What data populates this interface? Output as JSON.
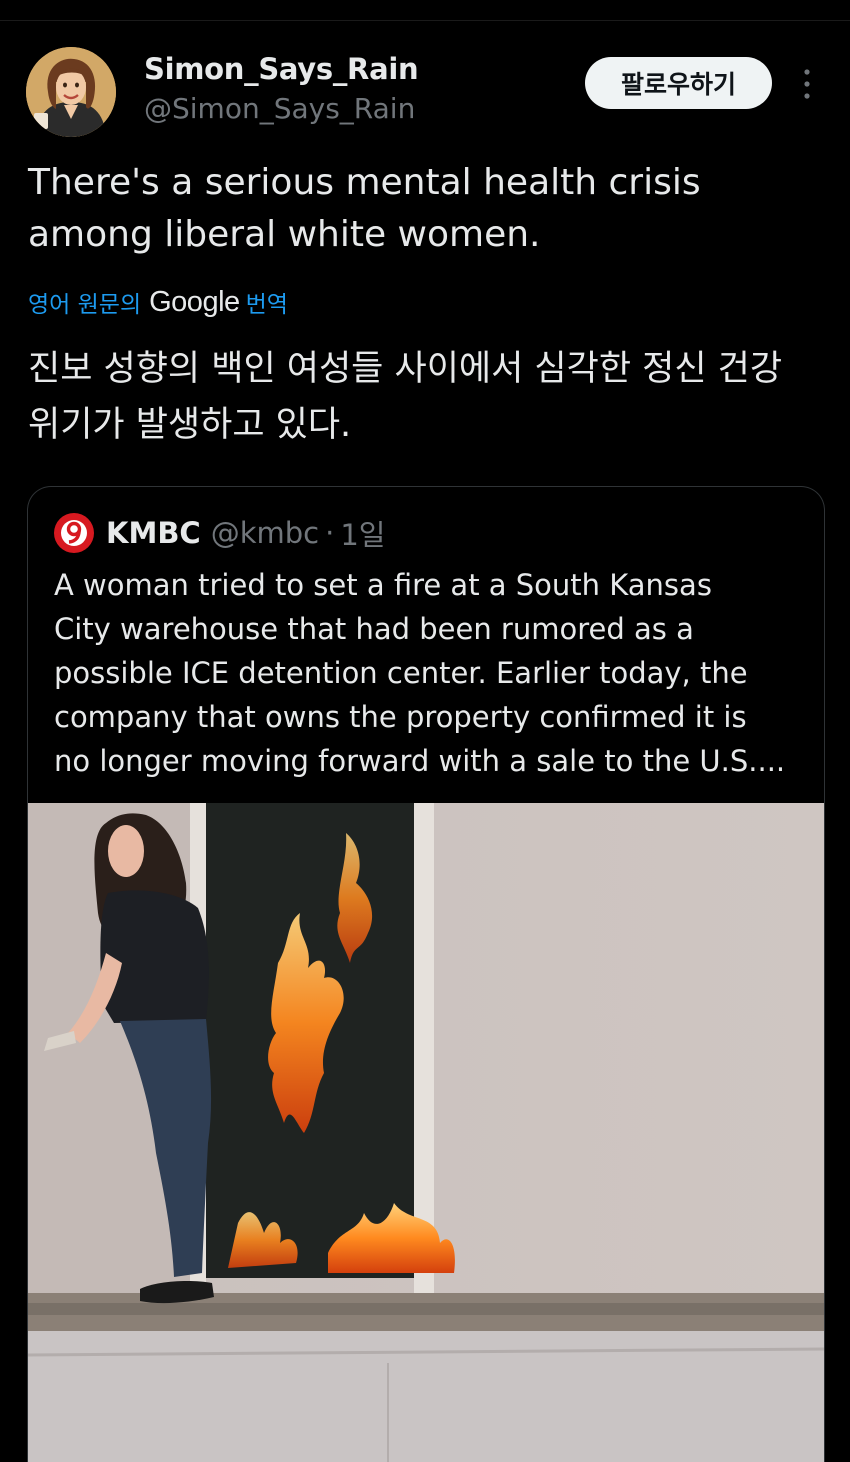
{
  "tweet": {
    "author": {
      "display_name": "Simon_Says_Rain",
      "handle": "@Simon_Says_Rain"
    },
    "follow_label": "팔로우하기",
    "more_icon": "more-vertical-icon",
    "text": "There's a serious mental health crisis\namong liberal white women.",
    "translation": {
      "prefix": "영어 원문의",
      "provider": "Google",
      "suffix": "번역",
      "text": "진보 성향의 백인 여성들 사이에서 심각한 정신 건강\n위기가 발생하고 있다."
    }
  },
  "quote": {
    "logo_icon": "kmbc-9-logo-icon",
    "name": "KMBC",
    "handle": "@kmbc",
    "separator": "·",
    "time": "1일",
    "text": "A woman tried to set a fire at a South Kansas\nCity warehouse that had been rumored as a\npossible ICE detention center. Earlier today, the\ncompany that owns the property confirmed it is\nno longer moving forward with a sale to the U.S....",
    "media": {
      "kind": "video-still",
      "description_icon": "warehouse-fire-photo"
    }
  },
  "colors": {
    "background": "#000000",
    "text_primary": "#e7e9ea",
    "text_secondary": "#71767b",
    "link": "#1d9bf0",
    "follow_bg": "#eff3f4",
    "kmbc_red": "#d71920"
  }
}
